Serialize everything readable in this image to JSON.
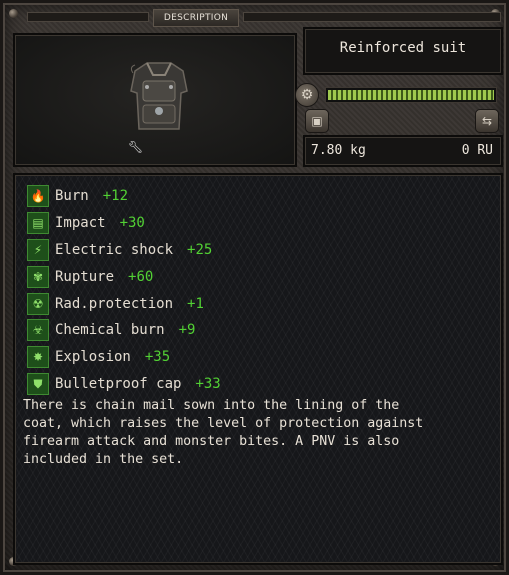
{
  "header": {
    "title": "DESCRIPTION"
  },
  "item": {
    "name": "Reinforced suit",
    "weight": "7.80 kg",
    "price": "0 RU",
    "condition": 1.0
  },
  "icons": {
    "suit": "armored-suit-icon",
    "upgrade": "wrench-icon",
    "settings": "gear-icon",
    "backpack": "backpack-icon",
    "unload": "unload-icon"
  },
  "protections": [
    {
      "label": "Burn",
      "value": "+12",
      "icon": "fire-icon",
      "glyph": "🔥"
    },
    {
      "label": "Impact",
      "value": "+30",
      "icon": "brick-wall-icon",
      "glyph": "▤"
    },
    {
      "label": "Electric shock",
      "value": "+25",
      "icon": "lightning-icon",
      "glyph": "⚡"
    },
    {
      "label": "Rupture",
      "value": "+60",
      "icon": "claw-paw-icon",
      "glyph": "✾"
    },
    {
      "label": "Rad.protection",
      "value": "+1",
      "icon": "radiation-icon",
      "glyph": "☢"
    },
    {
      "label": "Chemical burn",
      "value": "+9",
      "icon": "biohazard-icon",
      "glyph": "☣"
    },
    {
      "label": "Explosion",
      "value": "+35",
      "icon": "explosion-icon",
      "glyph": "✸"
    },
    {
      "label": "Bulletproof cap",
      "value": "+33",
      "icon": "vest-icon",
      "glyph": "⛊"
    }
  ],
  "description": "There is chain mail sown into the lining of the\ncoat, which raises the level of protection against\nfirearm attack and monster bites. A PNV is also\nincluded in the set.",
  "colors": {
    "bonus_green": "#52d134",
    "icon_green": "#1e4f1a",
    "condition_bar": "#9fc94f"
  }
}
